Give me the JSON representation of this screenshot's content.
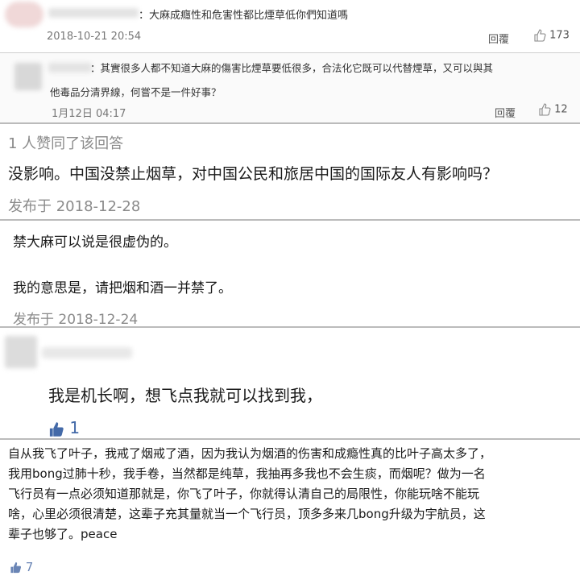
{
  "c1": {
    "text": "：大麻成癮性和危害性都比煙草低你們知道嗎",
    "date": "2018-10-21 20:54",
    "reply_label": "回覆",
    "likes": "173"
  },
  "c2": {
    "text_line1": "：其實很多人都不知道大麻的傷害比煙草要低很多，合法化它既可以代替煙草，又可以與其",
    "text_line2": "他毒品分清界線，何嘗不是一件好事？",
    "date": "1月12日 04:17",
    "reply_label": "回覆",
    "likes": "12"
  },
  "a1": {
    "agree": "1 人赞同了该回答",
    "text": "没影响。中国没禁止烟草，对中国公民和旅居中国的国际友人有影响吗？",
    "date": "发布于 2018-12-28"
  },
  "a2": {
    "line1": "禁大麻可以说是很虚伪的。",
    "line2": "我的意思是，请把烟和酒一并禁了。",
    "date": "发布于 2018-12-24"
  },
  "c3": {
    "text": "我是机长啊，想飞点我就可以找到我，",
    "likes": "1"
  },
  "c4": {
    "line1": "自从我飞了叶子，我戒了烟戒了酒，因为我认为烟酒的伤害和成瘾性真的比叶子高太多了，",
    "line2": "我用bong过肺十秒，我手卷，当然都是纯草，我抽再多我也不会生痰，而烟呢？做为一名",
    "line3": "飞行员有一点必须知道那就是，你飞了叶子，你就得认清自己的局限性，你能玩啥不能玩",
    "line4": "啥，心里必须很清楚，这辈子充其量就当一个飞行员，顶多多来几bong升级为宇航员，这",
    "line5": "辈子也够了。peace",
    "likes": "7"
  }
}
